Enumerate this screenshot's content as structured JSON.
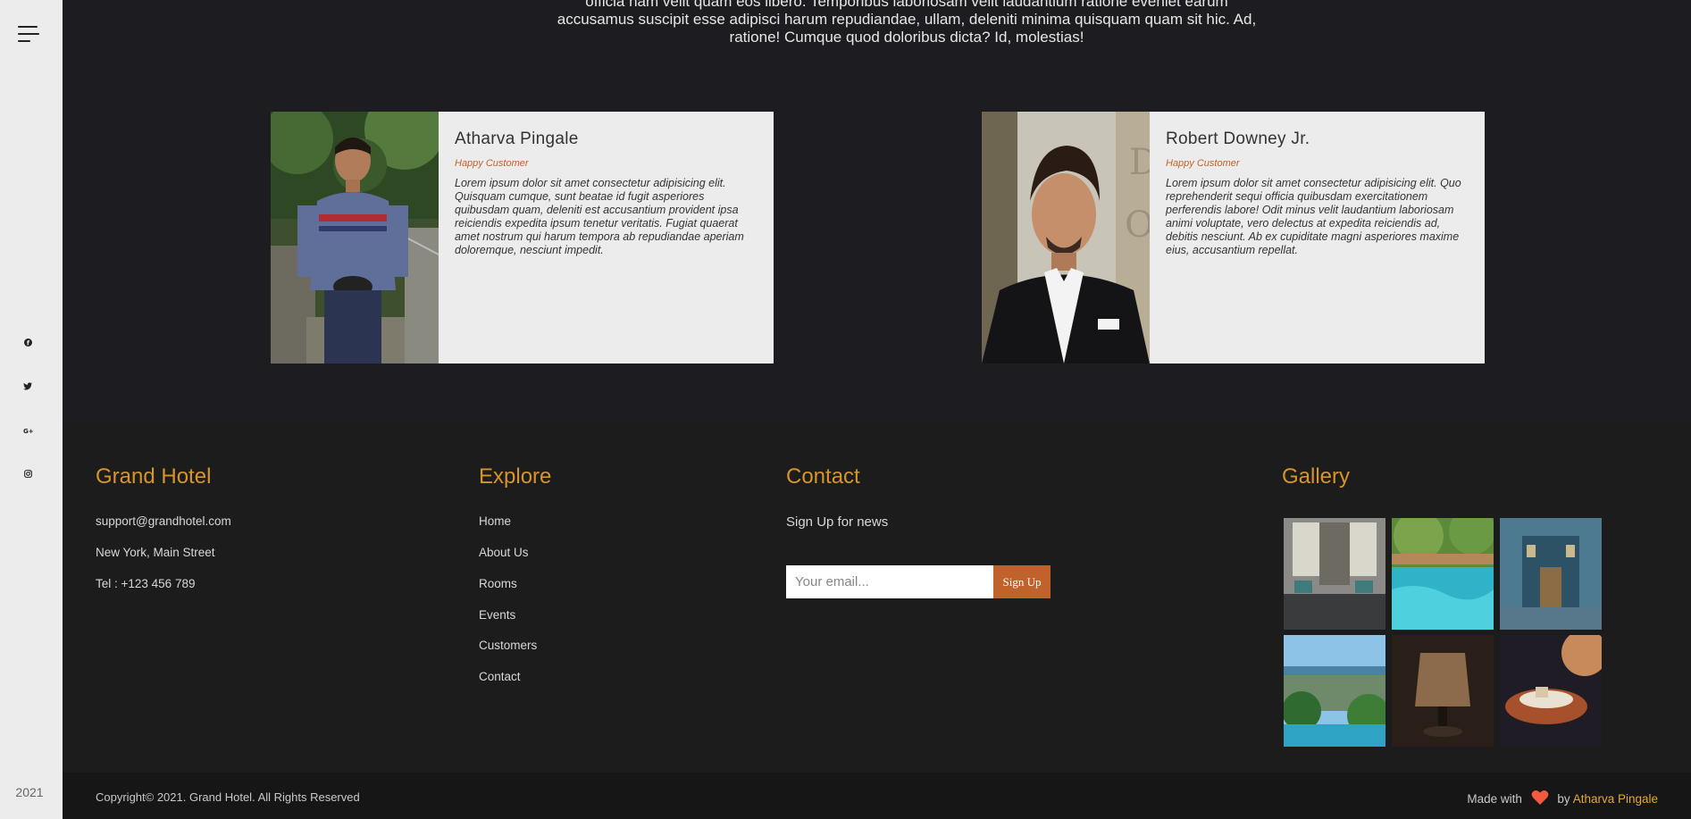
{
  "sidebar": {
    "menu_icon": "hamburger-menu-icon",
    "social_icons": [
      "facebook-icon",
      "twitter-icon",
      "google-plus-icon",
      "instagram-icon"
    ],
    "year": "2021"
  },
  "testimonials": {
    "intro_lines": [
      "officia nam velit quam eos libero. Temporibus laboriosam velit laudantium ratione eveniet earum",
      "accusamus suscipit esse adipisci harum repudiandae, ullam, deleniti minima quisquam quam sit hic. Ad,",
      "ratione! Cumque quod doloribus dicta? Id, molestias!"
    ],
    "cards": [
      {
        "name": "Atharva Pingale",
        "role": "Happy Customer",
        "quote": "Lorem ipsum dolor sit amet consectetur adipisicing elit. Quisquam cumque, sunt beatae id fugit asperiores quibusdam quam, deleniti est accusantium provident ipsa reiciendis expedita ipsum tenetur veritatis. Fugiat quaerat amet nostrum qui harum tempora ab repudiandae aperiam doloremque, nesciunt impedit."
      },
      {
        "name": "Robert Downey Jr.",
        "role": "Happy Customer",
        "quote": "Lorem ipsum dolor sit amet consectetur adipisicing elit. Quo reprehenderit sequi officia quibusdam exercitationem perferendis labore! Odit minus velit laudantium laboriosam animi voluptate, vero delectus at expedita reiciendis ad, debitis nesciunt. Ab ex cupiditate magni asperiores maxime eius, accusantium repellat."
      }
    ]
  },
  "footer": {
    "brand": {
      "title": "Grand Hotel",
      "email": "support@grandhotel.com",
      "address": "New York, Main Street",
      "phone": "Tel : +123 456 789"
    },
    "explore": {
      "title": "Explore",
      "links": [
        "Home",
        "About Us",
        "Rooms",
        "Events",
        "Customers",
        "Contact"
      ]
    },
    "contact": {
      "title": "Contact",
      "signup_text": "Sign Up for news",
      "email_placeholder": "Your email...",
      "button_label": "Sign Up"
    },
    "gallery": {
      "title": "Gallery"
    }
  },
  "bottom": {
    "copyright": "Copyright© 2021. Grand Hotel. All Rights Reserved",
    "made_with": "Made with",
    "by": "by",
    "author": "Atharva Pingale"
  },
  "colors": {
    "accent_gold": "#d6952a",
    "accent_orange": "#c0622b",
    "heart": "#f4593b"
  }
}
